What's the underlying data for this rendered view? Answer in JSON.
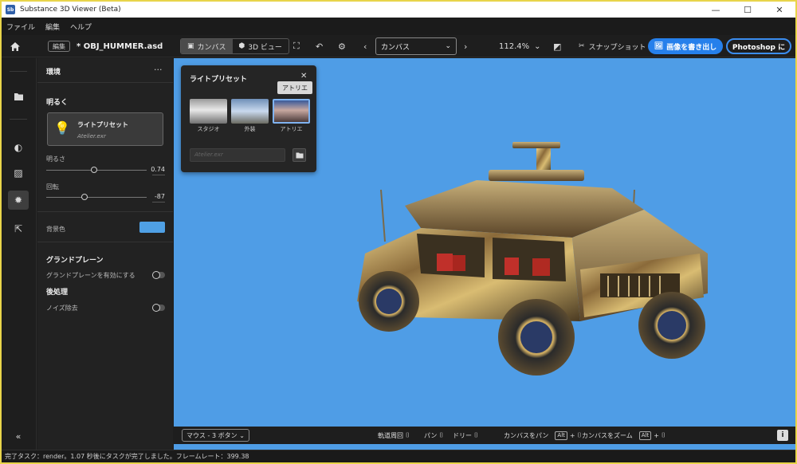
{
  "window": {
    "title": "Substance 3D Viewer (Beta)",
    "app_icon": "Sb",
    "controls": {
      "minimize": "—",
      "maximize": "☐",
      "close": "✕"
    }
  },
  "menu": [
    "ファイル",
    "編集",
    "ヘルプ"
  ],
  "toolbar": {
    "edit_badge": "編集",
    "file_name": "* OBJ_HUMMER.asd",
    "view_tabs": [
      {
        "label": "カンバス",
        "icon": "canvas-icon",
        "active": true
      },
      {
        "label": "3D ビュー",
        "icon": "3d-view-icon",
        "active": false
      }
    ],
    "camera_select": "カンバス",
    "zoom": "112.4%",
    "snapshot_label": "スナップショット",
    "export_label": "画像を書き出し",
    "photoshop_label": "Photoshop に"
  },
  "rail": {
    "collapse_glyph": "«"
  },
  "panel": {
    "title": "環境",
    "more": "···",
    "brightness_section": "明るく",
    "light_preset_label": "ライトプリセット",
    "light_preset_file": "Atelier.exr",
    "brightness_label": "明るさ",
    "brightness_value": "0.74",
    "brightness_fraction": 0.48,
    "rotation_label": "回転",
    "rotation_value": "-87",
    "rotation_fraction": 0.38,
    "background_label": "背景色",
    "background_color": "#4fa0e5",
    "ground_plane_section": "グランドプレーン",
    "ground_plane_toggle": "グランドプレーンを有効にする",
    "post_section": "後処理",
    "denoise_toggle": "ノイズ除去"
  },
  "popup": {
    "title": "ライトプリセット",
    "close": "✕",
    "tooltip": "アトリエ",
    "presets": [
      {
        "label": "スタジオ"
      },
      {
        "label": "外装"
      },
      {
        "label": "アトリエ",
        "selected": true
      }
    ],
    "file_placeholder": "Atelier.exr"
  },
  "viewport": {
    "background_color": "#4f9de6",
    "mouse_mode": "マウス - 3 ボタン",
    "hints": {
      "orbit": "軌道周回",
      "pan": "パン",
      "dolly": "ドリー",
      "canvas_pan": "カンバスをパン",
      "canvas_zoom": "カンバスをズーム",
      "alt_key": "Alt",
      "plus": "+"
    },
    "info": "i"
  },
  "status": "完了タスク：render。1.07 秒後にタスクが完了しました。フレームレート：399.38"
}
